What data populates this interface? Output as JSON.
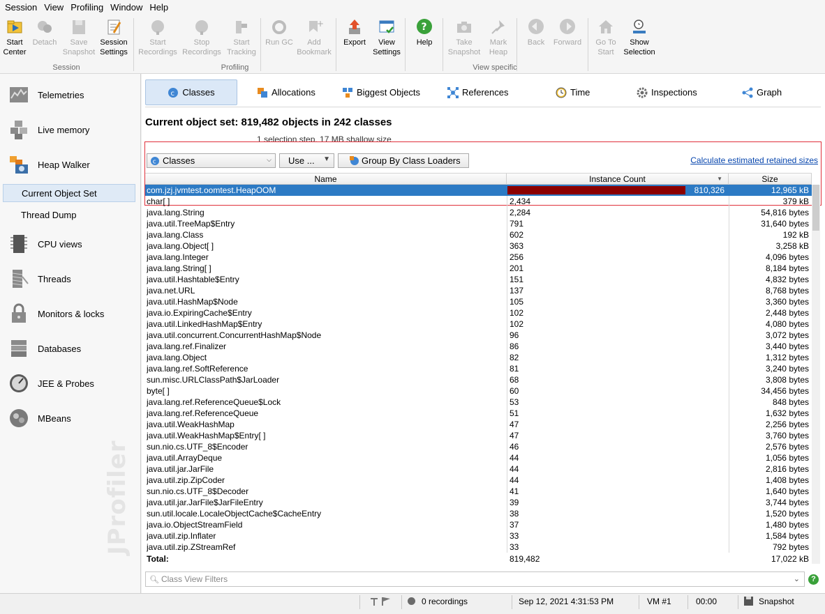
{
  "menu": [
    "Session",
    "View",
    "Profiling",
    "Window",
    "Help"
  ],
  "toolbar": {
    "groups": {
      "session": "Session",
      "profiling": "Profiling",
      "view_specific": "View specific"
    },
    "buttons": {
      "start_center": [
        "Start",
        "Center"
      ],
      "detach": [
        "Detach",
        ""
      ],
      "save_snapshot": [
        "Save",
        "Snapshot"
      ],
      "session_settings": [
        "Session",
        "Settings"
      ],
      "start_recordings": [
        "Start",
        "Recordings"
      ],
      "stop_recordings": [
        "Stop",
        "Recordings"
      ],
      "start_tracking": [
        "Start",
        "Tracking"
      ],
      "run_gc": [
        "Run GC",
        ""
      ],
      "add_bookmark": [
        "Add",
        "Bookmark"
      ],
      "export": [
        "Export",
        ""
      ],
      "view_settings": [
        "View",
        "Settings"
      ],
      "help": [
        "Help",
        ""
      ],
      "take_snapshot": [
        "Take",
        "Snapshot"
      ],
      "mark_heap": [
        "Mark",
        "Heap"
      ],
      "back": [
        "Back",
        ""
      ],
      "forward": [
        "Forward",
        ""
      ],
      "go_to_start": [
        "Go To",
        "Start"
      ],
      "show_selection": [
        "Show",
        "Selection"
      ]
    }
  },
  "sidebar": {
    "telemetries": "Telemetries",
    "live_memory": "Live memory",
    "heap_walker": "Heap Walker",
    "current_object_set": "Current Object Set",
    "thread_dump": "Thread Dump",
    "cpu_views": "CPU views",
    "threads": "Threads",
    "monitors_locks": "Monitors & locks",
    "databases": "Databases",
    "jee_probes": "JEE & Probes",
    "mbeans": "MBeans",
    "watermark": "JProfiler"
  },
  "tabs": {
    "classes": "Classes",
    "allocations": "Allocations",
    "biggest_objects": "Biggest Objects",
    "references": "References",
    "time": "Time",
    "inspections": "Inspections",
    "graph": "Graph"
  },
  "object_set": {
    "title": "Current object set:  819,482 objects in 242 classes",
    "subtitle": "1 selection step, 17 MB shallow size"
  },
  "controls": {
    "view_combo": "Classes",
    "use_button": "Use ...",
    "group_button": "Group By Class Loaders",
    "calc_link": "Calculate estimated retained sizes"
  },
  "table": {
    "headers": {
      "name": "Name",
      "count": "Instance Count",
      "size": "Size"
    },
    "rows": [
      {
        "name": "com.jzj.jvmtest.oomtest.HeapOOM",
        "count": "810,326",
        "size": "12,965 kB",
        "selected": true,
        "bar": 0.988
      },
      {
        "name": "char[ ]",
        "count": "2,434",
        "size": "379 kB"
      },
      {
        "name": "java.lang.String",
        "count": "2,284",
        "size": "54,816 bytes"
      },
      {
        "name": "java.util.TreeMap$Entry",
        "count": "791",
        "size": "31,640 bytes"
      },
      {
        "name": "java.lang.Class",
        "count": "602",
        "size": "192 kB"
      },
      {
        "name": "java.lang.Object[ ]",
        "count": "363",
        "size": "3,258 kB"
      },
      {
        "name": "java.lang.Integer",
        "count": "256",
        "size": "4,096 bytes"
      },
      {
        "name": "java.lang.String[ ]",
        "count": "201",
        "size": "8,184 bytes"
      },
      {
        "name": "java.util.Hashtable$Entry",
        "count": "151",
        "size": "4,832 bytes"
      },
      {
        "name": "java.net.URL",
        "count": "137",
        "size": "8,768 bytes"
      },
      {
        "name": "java.util.HashMap$Node",
        "count": "105",
        "size": "3,360 bytes"
      },
      {
        "name": "java.io.ExpiringCache$Entry",
        "count": "102",
        "size": "2,448 bytes"
      },
      {
        "name": "java.util.LinkedHashMap$Entry",
        "count": "102",
        "size": "4,080 bytes"
      },
      {
        "name": "java.util.concurrent.ConcurrentHashMap$Node",
        "count": "96",
        "size": "3,072 bytes"
      },
      {
        "name": "java.lang.ref.Finalizer",
        "count": "86",
        "size": "3,440 bytes"
      },
      {
        "name": "java.lang.Object",
        "count": "82",
        "size": "1,312 bytes"
      },
      {
        "name": "java.lang.ref.SoftReference",
        "count": "81",
        "size": "3,240 bytes"
      },
      {
        "name": "sun.misc.URLClassPath$JarLoader",
        "count": "68",
        "size": "3,808 bytes"
      },
      {
        "name": "byte[ ]",
        "count": "60",
        "size": "34,456 bytes"
      },
      {
        "name": "java.lang.ref.ReferenceQueue$Lock",
        "count": "53",
        "size": "848 bytes"
      },
      {
        "name": "java.lang.ref.ReferenceQueue",
        "count": "51",
        "size": "1,632 bytes"
      },
      {
        "name": "java.util.WeakHashMap",
        "count": "47",
        "size": "2,256 bytes"
      },
      {
        "name": "java.util.WeakHashMap$Entry[ ]",
        "count": "47",
        "size": "3,760 bytes"
      },
      {
        "name": "sun.nio.cs.UTF_8$Encoder",
        "count": "46",
        "size": "2,576 bytes"
      },
      {
        "name": "java.util.ArrayDeque",
        "count": "44",
        "size": "1,056 bytes"
      },
      {
        "name": "java.util.jar.JarFile",
        "count": "44",
        "size": "2,816 bytes"
      },
      {
        "name": "java.util.zip.ZipCoder",
        "count": "44",
        "size": "1,408 bytes"
      },
      {
        "name": "sun.nio.cs.UTF_8$Decoder",
        "count": "41",
        "size": "1,640 bytes"
      },
      {
        "name": "java.util.jar.JarFile$JarFileEntry",
        "count": "39",
        "size": "3,744 bytes"
      },
      {
        "name": "sun.util.locale.LocaleObjectCache$CacheEntry",
        "count": "38",
        "size": "1,520 bytes"
      },
      {
        "name": "java.io.ObjectStreamField",
        "count": "37",
        "size": "1,480 bytes"
      },
      {
        "name": "java.util.zip.Inflater",
        "count": "33",
        "size": "1,584 bytes"
      },
      {
        "name": "java.util.zip.ZStreamRef",
        "count": "33",
        "size": "792 bytes"
      }
    ],
    "total": {
      "label": "Total:",
      "count": "819,482",
      "size": "17,022 kB"
    }
  },
  "filter": {
    "placeholder": "Class View Filters"
  },
  "status": {
    "recordings": "0 recordings",
    "datetime": "Sep 12, 2021 4:31:53 PM",
    "vm": "VM #1",
    "time": "00:00",
    "mode": "Snapshot"
  },
  "colors": {
    "selection": "#2c7ac4",
    "bar": "#8b0000",
    "highlight_border": "#e0303a",
    "link": "#0645ad"
  }
}
